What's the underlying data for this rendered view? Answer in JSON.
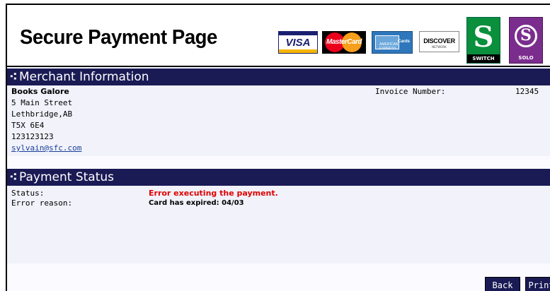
{
  "header": {
    "title": "Secure Payment Page",
    "cards": [
      {
        "name": "visa-logo",
        "label": "VISA"
      },
      {
        "name": "mastercard-logo",
        "label": "MasterCard"
      },
      {
        "name": "amex-logo",
        "label": "AMERICAN EXPRESS",
        "side": "Cards"
      },
      {
        "name": "discover-logo",
        "label": "DISCOVER",
        "sub": "NETWORK"
      },
      {
        "name": "switch-logo",
        "label": "SWITCH"
      },
      {
        "name": "solo-logo",
        "label": "SOLO"
      }
    ]
  },
  "merchant": {
    "section_title": "Merchant Information",
    "name": "Books Galore",
    "street": "5 Main Street",
    "city": "Lethbridge,AB",
    "postal": "T5X 6E4",
    "phone": "123123123",
    "email": "sylvain@sfc.com",
    "invoice_label": "Invoice Number:",
    "invoice_value": "12345"
  },
  "payment": {
    "section_title": "Payment Status",
    "status_label": "Status:",
    "status_value": "Error executing the payment.",
    "reason_label": "Error reason:",
    "reason_value": "Card has expired: 04/03"
  },
  "buttons": {
    "back": "Back",
    "print": "Print"
  },
  "colors": {
    "bar": "#1a1a55",
    "error": "#e00000",
    "panel": "#f1f2fa"
  }
}
